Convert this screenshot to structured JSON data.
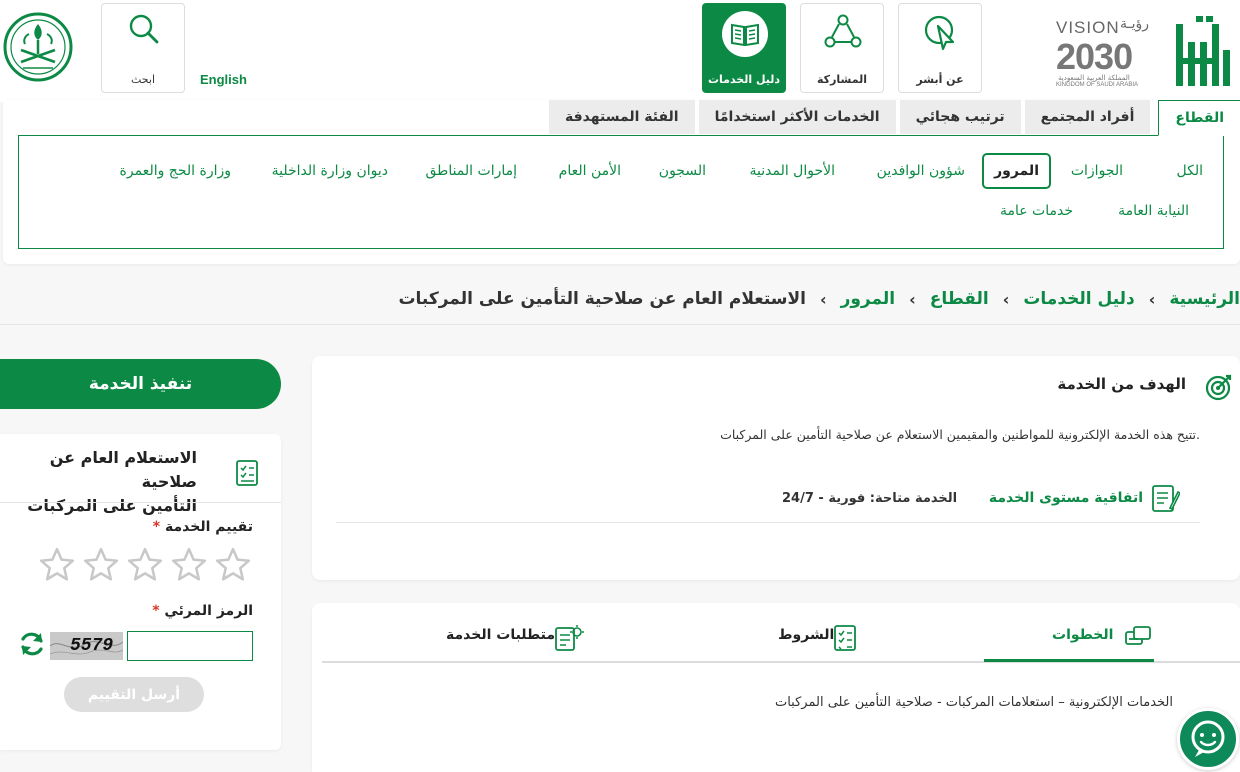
{
  "header": {
    "vision": {
      "word": "VISION",
      "roya": "رؤيـة",
      "year": "2030",
      "ar_kingdom": "المملكة العربية السعودية",
      "en_kingdom": "KINGDOM OF SAUDI ARABIA"
    },
    "tiles": [
      {
        "label": "عن أبشر",
        "icon": "cursor-click-icon"
      },
      {
        "label": "المشاركة",
        "icon": "people-network-icon"
      },
      {
        "label": "دليل الخدمات",
        "icon": "open-book-icon",
        "active": true
      }
    ],
    "english_label": "English",
    "search_label": "ابحث"
  },
  "sector_tabs": [
    "القطاع",
    "أفراد المجتمع",
    "ترتيب هجائي",
    "الخدمات الأكثر استخدامًا",
    "الفئة المستهدفة"
  ],
  "sectors": {
    "row1": [
      "الكل",
      "الجوازات",
      "المرور",
      "شؤون الوافدين",
      "الأحوال المدنية",
      "السجون",
      "الأمن العام",
      "إمارات المناطق",
      "ديوان وزارة الداخلية",
      "وزارة الحج والعمرة"
    ],
    "row2": [
      "النيابة العامة",
      "خدمات عامة"
    ],
    "selected": "المرور"
  },
  "breadcrumb": {
    "items": [
      "الرئيسية",
      "دليل الخدمات",
      "القطاع",
      "المرور"
    ],
    "current": "الاستعلام العام عن صلاحية التأمين على المركبات",
    "separator": "›"
  },
  "goal": {
    "title": "الهدف من الخدمة",
    "description": "تتيح هذه الخدمة الإلكترونية للمواطنين والمقيمين الاستعلام عن صلاحية التأمين على المركبات.",
    "sla_label": "اتفاقية مستوى الخدمة",
    "availability": "الخدمة متاحة: فورية - 24/7"
  },
  "steps": {
    "tabs": [
      "الخطوات",
      "الشروط",
      "متطلبات الخدمة"
    ],
    "active_tab": "الخطوات",
    "content": "الخدمات الإلكترونية – استعلامات المركبات - صلاحية التأمين على المركبات"
  },
  "sidebar": {
    "execute_label": "تنفيذ الخدمة",
    "service_title_line1": "الاستعلام العام عن صلاحية",
    "service_title_line2": "التأمين على المركبات",
    "rating_label": "تقييم الخدمة",
    "rating_stars": 5,
    "rating_value": 0,
    "captcha_label": "الرمز المرئي",
    "captcha_text": "5579",
    "required_mark": "*",
    "submit_label": "أرسل التقييم"
  },
  "colors": {
    "brand": "#0c8a45",
    "required": "#d9342b"
  }
}
